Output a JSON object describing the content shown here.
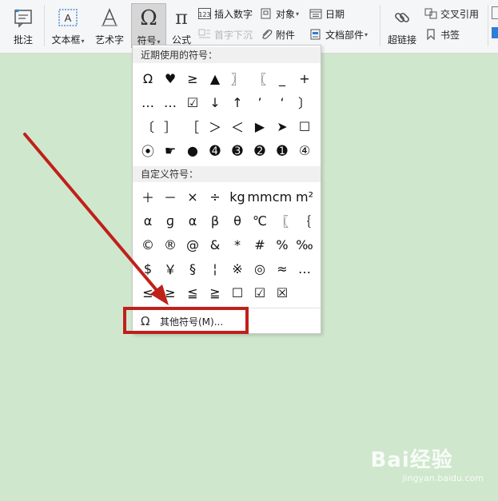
{
  "ribbon": {
    "comment": {
      "label": "批注",
      "icon": "comment-icon"
    },
    "textbox": {
      "label": "文本框",
      "icon": "textbox-icon"
    },
    "wordart": {
      "label": "艺术字",
      "icon": "wordart-icon"
    },
    "symbol": {
      "label": "符号",
      "icon": "omega-icon"
    },
    "formula": {
      "label": "公式",
      "icon": "pi-icon"
    },
    "insert_number": {
      "label": "插入数字",
      "icon": "number-icon"
    },
    "drop_cap": {
      "label": "首字下沉",
      "icon": "dropcap-icon"
    },
    "object": {
      "label": "对象",
      "icon": "object-icon"
    },
    "attachment": {
      "label": "附件",
      "icon": "paperclip-icon"
    },
    "date": {
      "label": "日期",
      "icon": "calendar-icon"
    },
    "doc_parts": {
      "label": "文档部件",
      "icon": "docparts-icon"
    },
    "hyperlink": {
      "label": "超链接",
      "icon": "link-icon"
    },
    "cross_ref": {
      "label": "交叉引用",
      "icon": "crossref-icon"
    },
    "bookmark": {
      "label": "书签",
      "icon": "bookmark-icon"
    }
  },
  "symbol_menu": {
    "recent_title": "近期使用的符号：",
    "recent_symbols": [
      "Ω",
      "♥",
      "≥",
      "▲",
      "〗",
      "〖",
      "_",
      "+",
      "…",
      "…",
      "☑",
      "↓",
      "↑",
      "’",
      "‘",
      "〕",
      "〔",
      "］",
      "［",
      "＞",
      "＜",
      "▶",
      "➤",
      "☐",
      "⦿",
      "☛",
      "●",
      "➍",
      "➌",
      "➋",
      "➊",
      "④"
    ],
    "custom_title": "自定义符号：",
    "custom_symbols": [
      "＋",
      "－",
      "×",
      "÷",
      "kg",
      "mm",
      "cm",
      "m²",
      "α",
      "ɡ",
      "α",
      "β",
      "θ",
      "℃",
      "〖",
      "｛",
      "©",
      "®",
      "@",
      "&",
      "*",
      "#",
      "%",
      "‰",
      "$",
      "￥",
      "§",
      "¦",
      "※",
      "◎",
      "≈",
      "…",
      "≤",
      "≥",
      "≦",
      "≧",
      "☐",
      "☑",
      "☒"
    ],
    "more_label": "其他符号(M)...",
    "more_icon": "omega-icon"
  },
  "annotation": {
    "color": "#c0201a"
  },
  "watermark": {
    "main": "Bai经验",
    "sub": "jingyan.baidu.com"
  }
}
